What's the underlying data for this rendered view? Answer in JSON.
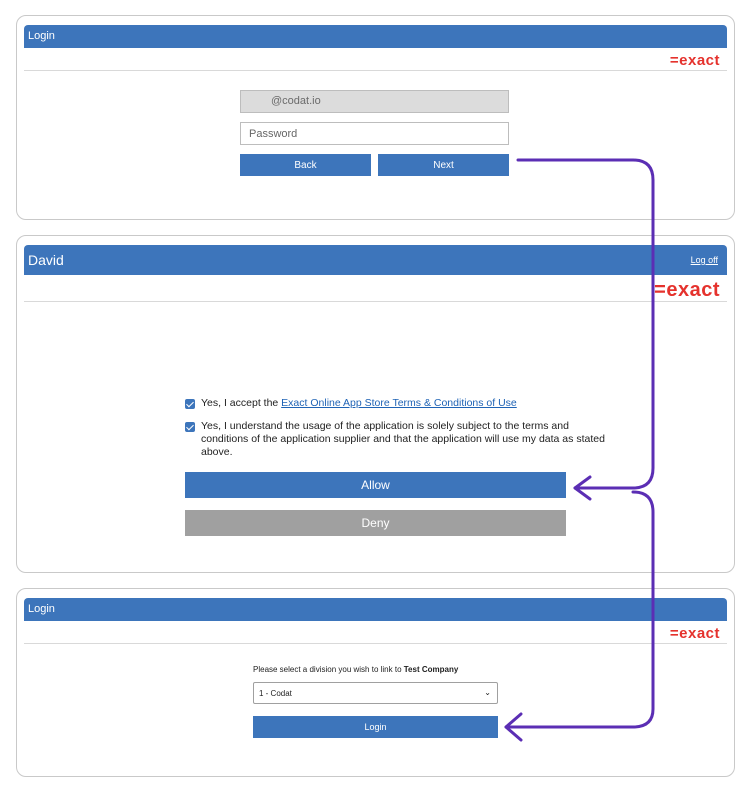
{
  "login_card": {
    "title": "Login",
    "logo_text": "=exact",
    "email_value": "@codat.io",
    "password_placeholder": "Password",
    "back_label": "Back",
    "next_label": "Next"
  },
  "consent_card": {
    "user_name": "David",
    "logoff_label": "Log off",
    "logo_text": "=exact",
    "terms_prefix": "Yes, I accept the ",
    "terms_link": "Exact Online App Store Terms & Conditions of Use",
    "usage_text": "Yes, I understand the usage of the application is solely subject to the terms and conditions of the application supplier and that the application will use my data as stated above.",
    "allow_label": "Allow",
    "deny_label": "Deny"
  },
  "division_card": {
    "title": "Login",
    "logo_text": "=exact",
    "prompt_prefix": "Please select a division you wish to link to ",
    "company": "Test Company",
    "selected_division": "1 - Codat",
    "login_label": "Login"
  },
  "colors": {
    "header_blue": "#3d75bb",
    "logo_red": "#e5322d",
    "arrow_purple": "#5b2eb4",
    "deny_gray": "#a0a0a0"
  }
}
